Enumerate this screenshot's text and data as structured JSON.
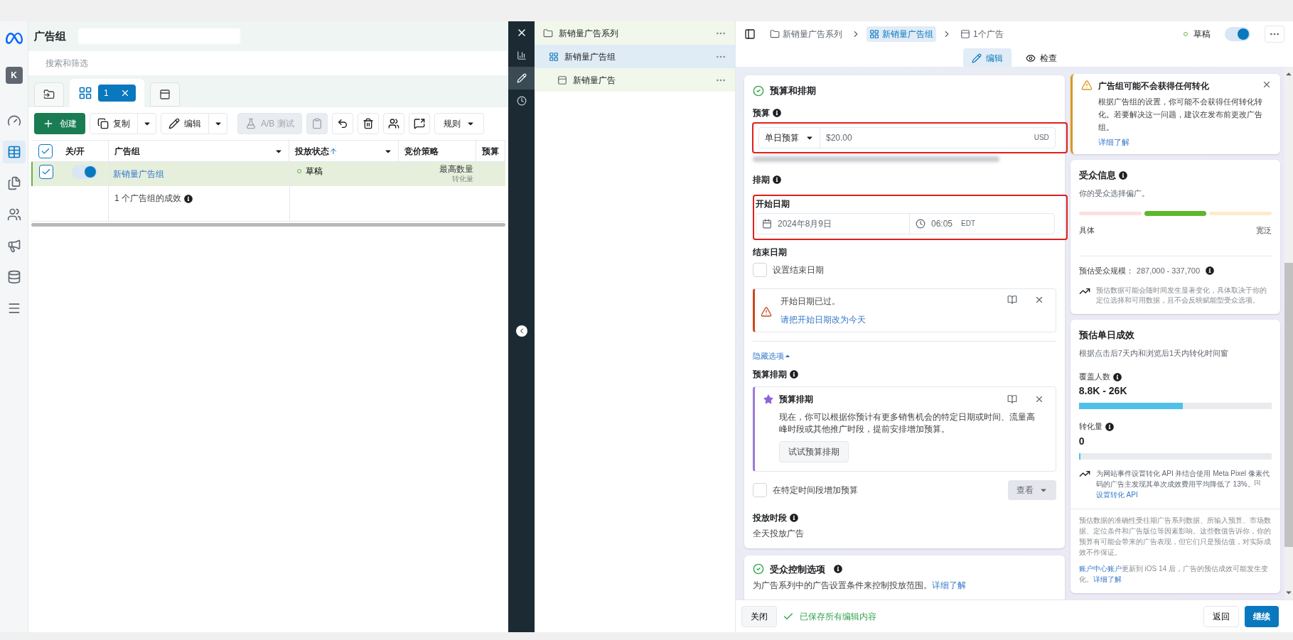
{
  "app_header": {
    "title": "广告组"
  },
  "search": {
    "placeholder": "搜索和筛选"
  },
  "avatar": {
    "letter": "K"
  },
  "rail": [
    {
      "kind": "gauge",
      "selected": false
    },
    {
      "kind": "table",
      "selected": true
    },
    {
      "kind": "pages",
      "selected": false
    },
    {
      "kind": "people",
      "selected": false
    },
    {
      "kind": "megaphone",
      "selected": false
    },
    {
      "kind": "files",
      "selected": false
    },
    {
      "kind": "menu",
      "selected": false
    }
  ],
  "view_tabs": [
    {
      "kind": "folder",
      "selected": false
    },
    {
      "kind": "adsets",
      "count": "1",
      "selected": true
    },
    {
      "kind": "ads",
      "selected": false
    }
  ],
  "toolbar": [
    {
      "kind": "create",
      "label": "创建",
      "disabled": false
    },
    {
      "kind": "copy",
      "label": "复制",
      "disabled": false
    },
    {
      "kind": "edit",
      "label": "编辑",
      "disabled": false
    },
    {
      "kind": "abtest",
      "label": "A/B 测试",
      "disabled": true
    },
    {
      "kind": "clipboard",
      "disabled": true
    },
    {
      "kind": "undo",
      "disabled": false
    },
    {
      "kind": "trash",
      "disabled": false
    },
    {
      "kind": "people",
      "disabled": false
    },
    {
      "kind": "comment",
      "disabled": false
    },
    {
      "kind": "rules",
      "label": "规则",
      "disabled": false
    }
  ],
  "table": {
    "header_checked": true,
    "columns": [
      {
        "label": "关/开",
        "menu": false,
        "sorted": false
      },
      {
        "label": "广告组",
        "menu": true,
        "sorted": false
      },
      {
        "label": "投放状态",
        "menu": true,
        "sorted": true
      },
      {
        "label": "竞价策略",
        "menu": false,
        "sorted": false
      },
      {
        "label": "预算",
        "menu": false,
        "sorted": false
      }
    ],
    "rows": [
      {
        "checked": true,
        "on": true,
        "name": "新销量广告组",
        "status": "草稿",
        "bid_strategy": "最高数量",
        "bid_sub": "转化量"
      }
    ],
    "summary": "1 个广告组的成效"
  },
  "side_strip": [
    {
      "kind": "chart",
      "selected": false
    },
    {
      "kind": "pencil",
      "selected": true
    },
    {
      "kind": "clock",
      "selected": false
    }
  ],
  "tree": [
    {
      "label": "新销量广告系列",
      "kind": "campaign",
      "selected": false,
      "children": [
        {
          "label": "新销量广告组",
          "kind": "adset",
          "selected": true,
          "children": [
            {
              "label": "新销量广告",
              "kind": "ad",
              "selected": false
            }
          ]
        }
      ]
    }
  ],
  "breadcrumb": [
    {
      "label": "新销量广告系列",
      "kind": "campaign",
      "selected": false
    },
    {
      "label": "新销量广告组",
      "kind": "adset",
      "selected": true
    },
    {
      "label": "1个广告",
      "kind": "ad",
      "selected": false
    }
  ],
  "status": {
    "label": "草稿",
    "on": true
  },
  "editor_tabs": [
    {
      "label": "编辑",
      "kind": "pencil",
      "selected": true
    },
    {
      "label": "检查",
      "kind": "eye",
      "selected": false
    }
  ],
  "budget_section": {
    "title": "预算和排期",
    "budget_label": "预算",
    "budget_type": "单日预算",
    "amount": "$20.00",
    "currency": "USD",
    "schedule_label": "排期",
    "start_label": "开始日期",
    "start_date": "2024年8月9日",
    "start_time": "06:05",
    "timezone": "EDT",
    "end_label": "结束日期",
    "end_checkbox": {
      "label": "设置结束日期",
      "checked": false
    },
    "alert": {
      "title": "开始日期已过。",
      "link": "请把开始日期改为今天"
    },
    "toggle_link": "隐藏选项",
    "budget_scheduling_label": "预算排期",
    "promo": {
      "title": "预算排期",
      "body": "现在，你可以根据你预计有更多销售机会的特定日期或时间、流量高峰时段或其他推广时段，提前安排增加预算。",
      "button": "试试预算排期"
    },
    "increase_checkbox": {
      "label": "在特定时间段增加预算",
      "checked": false
    },
    "view_button": "查看",
    "delivery_label": "投放时段",
    "delivery_value": "全天投放广告"
  },
  "audience_control": {
    "title": "受众控制选项",
    "body": "为广告系列中的广告设置条件来控制投放范围。",
    "link": "详细了解"
  },
  "warning": {
    "title": "广告组可能不会获得任何转化",
    "body": "根据广告组的设置，你可能不会获得任何转化转化。若要解决这一问题，建议在发布前更改广告组。",
    "link": "详细了解"
  },
  "audience": {
    "title": "受众信息",
    "subtitle": "你的受众选择偏广。",
    "segments": [
      {
        "selected": false,
        "color": "#fbe0df"
      },
      {
        "selected": true,
        "color": "#5cb82a"
      },
      {
        "selected": false,
        "color": "#fdebcb"
      }
    ],
    "low_label": "具体",
    "high_label": "宽泛",
    "size_label": "预估受众规模：",
    "size_value": "287,000 - 337,700",
    "note": "预估数据可能会随时间发生显著变化，具体取决于你的定位选择和可用数据，且不会反映赋能型受众选项。"
  },
  "estimate": {
    "title": "预估单日成效",
    "subtitle": "根据点击后7天内和浏览后1天内转化时间窗",
    "metrics": [
      {
        "label": "覆盖人数",
        "value": "8.8K - 26K",
        "level": 0.54
      },
      {
        "label": "转化量",
        "value": "0",
        "level": 0.005
      }
    ],
    "tip": "为网站事件设置转化 API 并结合使用 Meta Pixel 像素代码的广告主发现其单次成效费用平均降低了 13%。$^{[1]}$",
    "tip_link": "设置转化 API",
    "disclaimer": "预估数据的准确性受往期广告系列数据、所输入预算、市场数据、定位条件和广告版位等因素影响。这些数值告诉你，你的预算有可能会带来的广告表现，但它们只是预估值，对实际成效不作保证。",
    "ios_link": "账户中心账户",
    "ios_text": "更新到 iOS 14 后，广告的预估成效可能发生变化。",
    "ios_more": "详细了解"
  },
  "footer": {
    "close": "关闭",
    "saved": "已保存所有编辑内容",
    "back": "返回",
    "continue": "继续"
  }
}
